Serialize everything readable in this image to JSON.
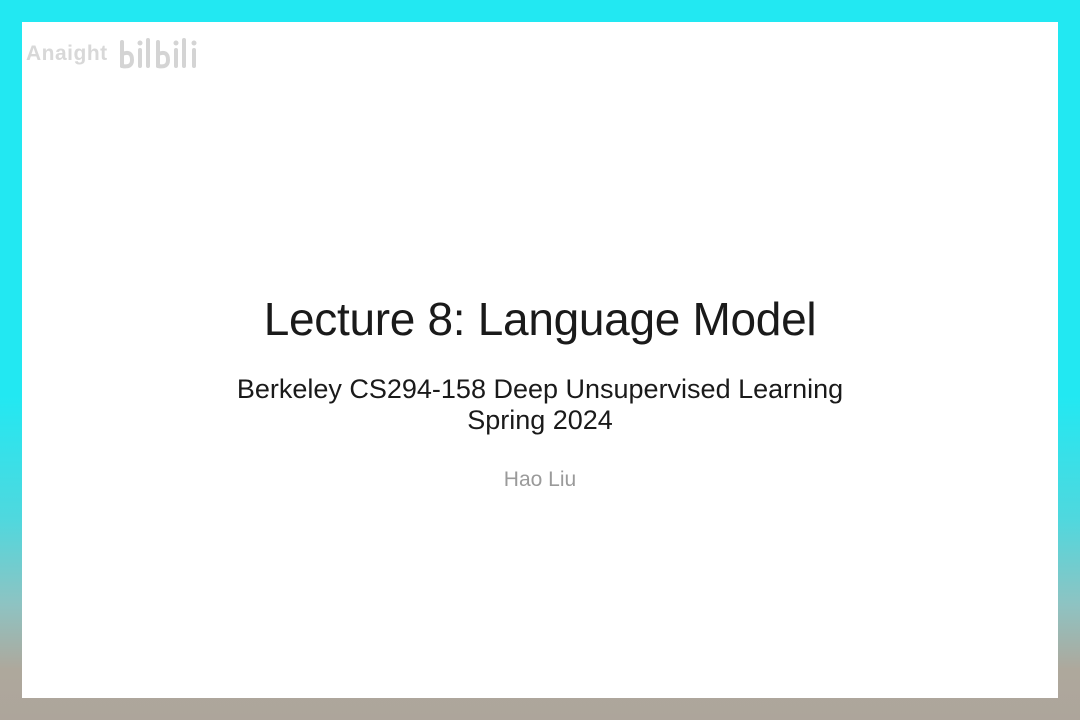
{
  "watermark": {
    "text": "Anaight",
    "logo_icon": "bilibili-logo-icon"
  },
  "slide": {
    "title": "Lecture 8: Language Model",
    "subtitle_line1": "Berkeley CS294-158 Deep Unsupervised Learning",
    "subtitle_line2": "Spring 2024",
    "author": "Hao Liu"
  },
  "colors": {
    "frame_top": "#22e8f2",
    "frame_bottom": "#ada59b",
    "title_text": "#1a1a1a",
    "author_text": "#9a9a9a"
  }
}
